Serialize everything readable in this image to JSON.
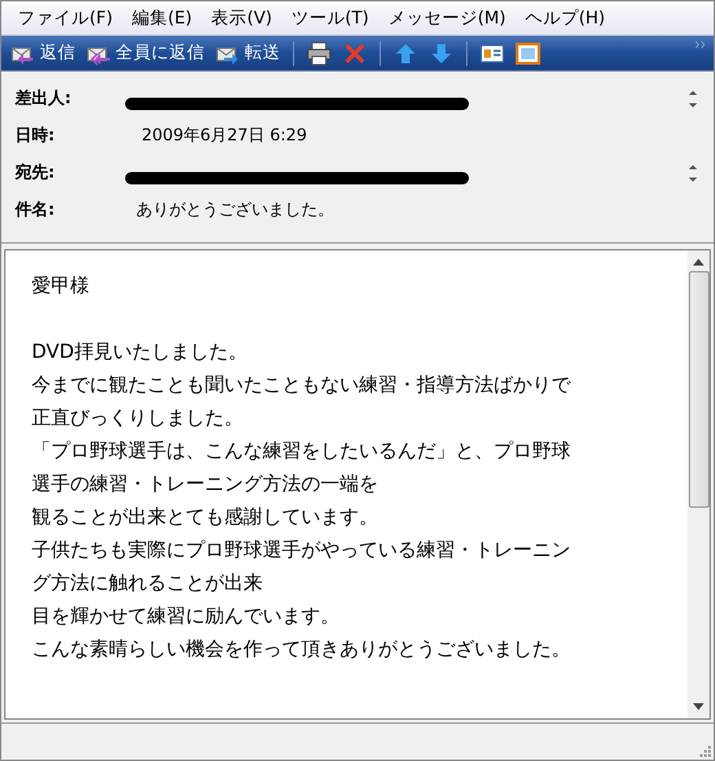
{
  "menu": [
    "ファイル(F)",
    "編集(E)",
    "表示(V)",
    "ツール(T)",
    "メッセージ(M)",
    "ヘルプ(H)"
  ],
  "toolbar": [
    {
      "kind": "labeled",
      "label": "返信"
    },
    {
      "kind": "labeled",
      "label": "全員に返信"
    },
    {
      "kind": "labeled",
      "label": "転送"
    },
    {
      "kind": "separator"
    },
    {
      "kind": "icon"
    },
    {
      "kind": "icon"
    },
    {
      "kind": "separator"
    },
    {
      "kind": "icon"
    },
    {
      "kind": "icon"
    },
    {
      "kind": "separator"
    },
    {
      "kind": "icon"
    },
    {
      "kind": "icon"
    }
  ],
  "header": [
    {
      "label": "差出人:",
      "redacted": true,
      "scrollable": true
    },
    {
      "label": "日時:",
      "value": "2009年6月27日 6:29",
      "redacted": false,
      "scrollable": false
    },
    {
      "label": "宛先:",
      "redacted": true,
      "scrollable": true
    },
    {
      "label": "件名:",
      "value": "ありがとうございました。",
      "redacted": false,
      "scrollable": false
    }
  ],
  "body": {
    "paragraphs": [
      [
        "愛甲様"
      ],
      [
        "DVD拝見いたしました。",
        "今までに観たことも聞いたこともない練習・指導方法ばかりで",
        "正直びっくりしました。",
        "「プロ野球選手は、こんな練習をしたいるんだ」と、プロ野球",
        "選手の練習・トレーニング方法の一端を",
        "観ることが出来とても感謝しています。",
        "子供たちも実際にプロ野球選手がやっている練習・トレーニン",
        "グ方法に触れることが出来",
        "目を輝かせて練習に励んでいます。",
        "こんな素晴らしい機会を作って頂きありがとうございました。"
      ]
    ]
  }
}
